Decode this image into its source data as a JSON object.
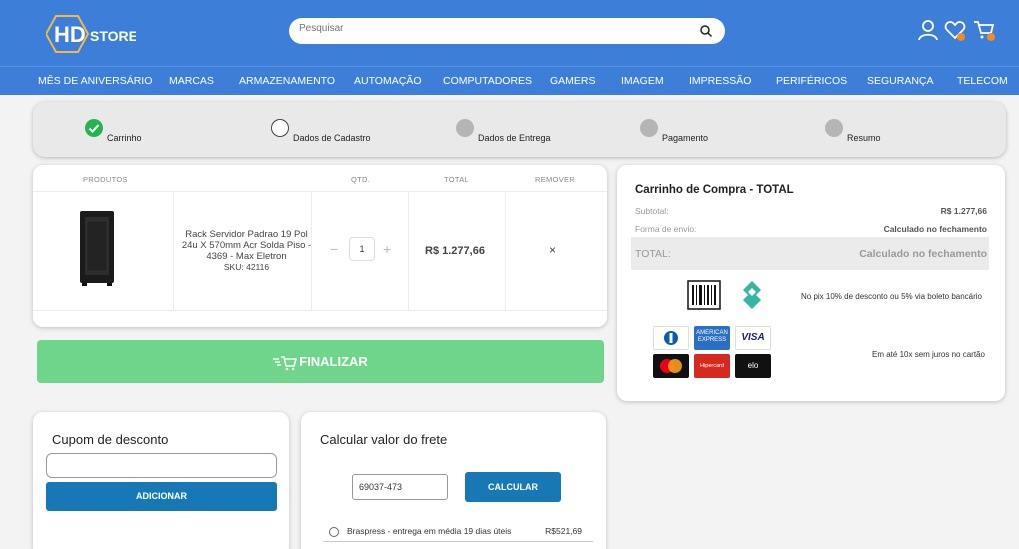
{
  "header": {
    "logo_text_hd": "HD",
    "logo_text_store": "STORE",
    "search_placeholder": "Pesquisar",
    "accent_color": "#3d7fd8"
  },
  "nav": [
    "MÊS DE ANIVERSÁRIO",
    "MARCAS",
    "ARMAZENAMENTO",
    "AUTOMAÇÃO",
    "COMPUTADORES",
    "GAMERS",
    "IMAGEM",
    "IMPRESSÃO",
    "PERIFÉRICOS",
    "SEGURANÇA",
    "TELECOM"
  ],
  "steps": [
    {
      "label": "Carrinho",
      "state": "done"
    },
    {
      "label": "Dados de Cadastro",
      "state": "current"
    },
    {
      "label": "Dados de Entrega",
      "state": "pending"
    },
    {
      "label": "Pagamento",
      "state": "pending"
    },
    {
      "label": "Resumo",
      "state": "pending"
    }
  ],
  "cart": {
    "headers": {
      "product": "PRODUTOS",
      "qty": "QTD.",
      "total": "TOTAL",
      "remove": "REMOVER"
    },
    "item": {
      "name": "Rack Servidor Padrao 19 Pol 24u X 570mm Acr Solda Piso - 4369 - Max Eletron",
      "sku": "SKU: 42116",
      "qty": "1",
      "total": "R$ 1.277,66",
      "remove_symbol": "×"
    }
  },
  "finalizar_label": "FINALIZAR",
  "summary": {
    "title": "Carrinho de Compra - TOTAL",
    "subtotal_label": "Subtotal:",
    "subtotal_value": "R$ 1.277,66",
    "shipping_label": "Forma de envio:",
    "shipping_value": "Calculado no fechamento",
    "total_label": "TOTAL:",
    "total_value": "Calculado no fechamento",
    "pix_text": "No pix 10% de desconto ou 5% via boleto bancário",
    "installments_text": "Em até 10x sem juros no cartão",
    "card_brands": {
      "amex_line1": "AMERICAN",
      "amex_line2": "EXPRESS",
      "visa": "VISA",
      "hipercard": "Hipercard",
      "elo": "elo"
    }
  },
  "coupon": {
    "title": "Cupom de desconto",
    "input_value": "",
    "button": "ADICIONAR"
  },
  "frete": {
    "title": "Calcular valor do frete",
    "cep_value": "69037-473",
    "button": "CALCULAR",
    "option_label": "Braspress - entrega em média 19 dias úteis",
    "option_price": "R$521,69"
  }
}
